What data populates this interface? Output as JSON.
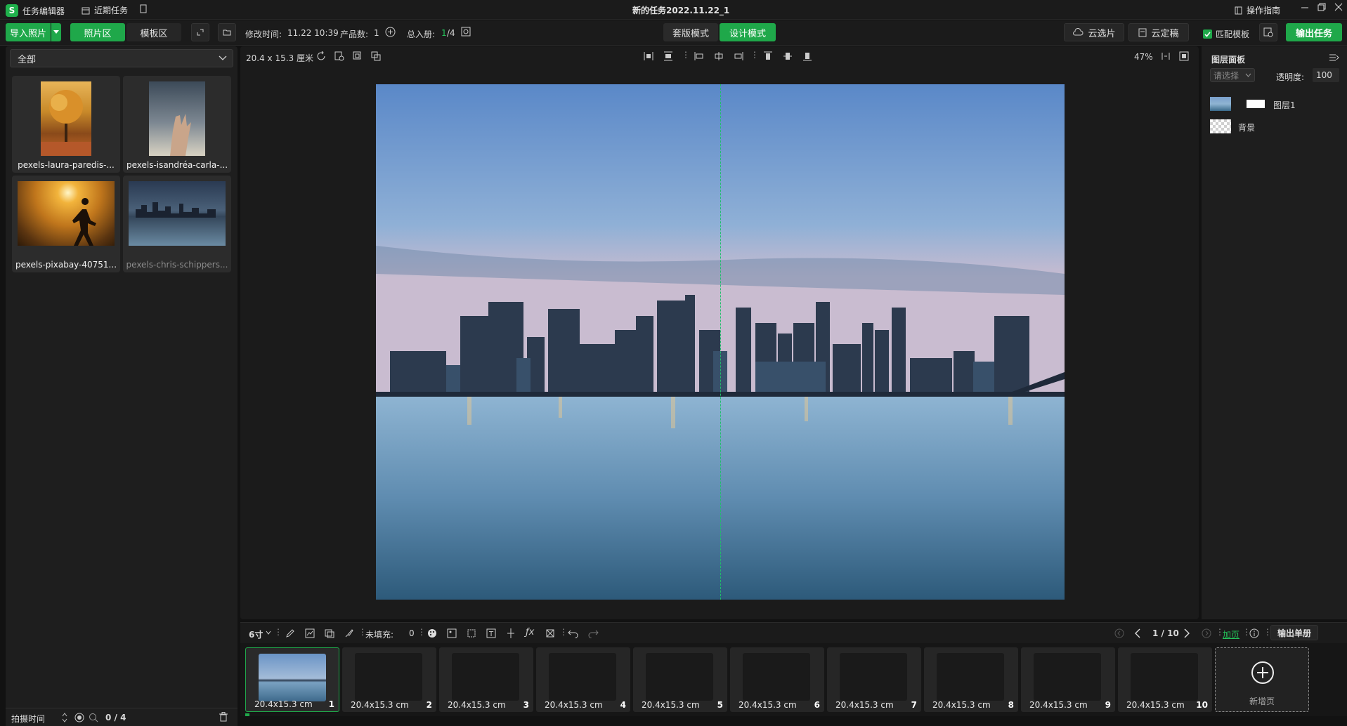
{
  "titlebar": {
    "app_name": "任务编辑器",
    "recent_tasks": "近期任务",
    "title": "新的任务2022.11.22_1",
    "guide": "操作指南"
  },
  "toolbar": {
    "import_label": "导入照片",
    "photo_area": "照片区",
    "template_area": "模板区",
    "modified_label": "修改时间:",
    "modified_value": "11.22 10:39",
    "products_label": "产品数:",
    "products_value": "1",
    "total_label": "总入册:",
    "total_current": "1",
    "total_rest": "/4",
    "mode_set": "套版模式",
    "mode_design": "设计模式",
    "cloud_select": "云选片",
    "cloud_final": "云定稿",
    "match_template": "匹配模板",
    "export_task": "输出任务"
  },
  "left": {
    "filter_value": "全部",
    "photos": [
      {
        "name": "pexels-laura-paredis-..."
      },
      {
        "name": "pexels-isandréa-carla-..."
      },
      {
        "name": "pexels-pixabay-40751..."
      },
      {
        "name": "pexels-chris-schippers..."
      }
    ],
    "footer_sort": "拍摄时间",
    "footer_count": "0 / 4"
  },
  "canvas": {
    "size_label": "20.4 x 15.3 厘米",
    "zoom": "47%"
  },
  "right": {
    "title": "图层面板",
    "select_placeholder": "请选择",
    "opacity_label": "透明度:",
    "opacity_value": "100",
    "layers": [
      {
        "name": "图层1"
      },
      {
        "name": "背景"
      }
    ]
  },
  "bottom": {
    "size_select": "6寸",
    "unfilled_label": "未填充:",
    "unfilled_value": "0",
    "pager": "1 / 10",
    "add_page_link": "加页",
    "export_single": "输出单册",
    "new_page": "新增页"
  },
  "pages": [
    {
      "size": "20.4x15.3 cm",
      "num": "1"
    },
    {
      "size": "20.4x15.3 cm",
      "num": "2"
    },
    {
      "size": "20.4x15.3 cm",
      "num": "3"
    },
    {
      "size": "20.4x15.3 cm",
      "num": "4"
    },
    {
      "size": "20.4x15.3 cm",
      "num": "5"
    },
    {
      "size": "20.4x15.3 cm",
      "num": "6"
    },
    {
      "size": "20.4x15.3 cm",
      "num": "7"
    },
    {
      "size": "20.4x15.3 cm",
      "num": "8"
    },
    {
      "size": "20.4x15.3 cm",
      "num": "9"
    },
    {
      "size": "20.4x15.3 cm",
      "num": "10"
    }
  ],
  "colors": {
    "accent_green": "#1fa84a",
    "link_green": "#23c45a"
  }
}
